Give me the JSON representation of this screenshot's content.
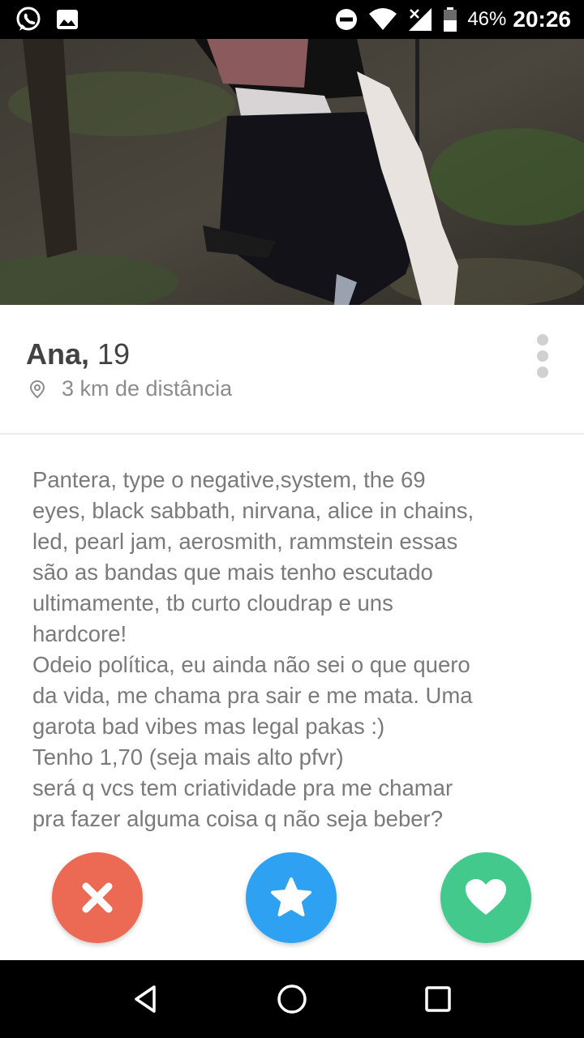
{
  "status_bar": {
    "battery_percent": "46%",
    "time": "20:26",
    "icons": [
      "whatsapp-icon",
      "image-icon",
      "do-not-disturb-icon",
      "wifi-icon",
      "signal-icon",
      "battery-icon"
    ]
  },
  "profile": {
    "name": "Ana,",
    "age": "19",
    "distance": "3 km de distância",
    "bio_lines": [
      "Pantera, type o negative,system, the 69",
      "eyes, black sabbath, nirvana, alice in chains,",
      "led, pearl jam, aerosmith, rammstein essas",
      "são as bandas que mais tenho escutado",
      "ultimamente, tb curto cloudrap e uns",
      "hardcore!",
      "Odeio política, eu ainda não sei o que quero",
      "da vida, me chama pra sair e me mata. Uma",
      "garota bad vibes mas legal pakas :)",
      "Tenho 1,70 (seja mais alto pfvr)",
      "será q vcs tem criatividade pra me chamar",
      "pra fazer alguma coisa q não seja beber?"
    ]
  },
  "actions": {
    "nope_color": "#ec6a53",
    "super_like_color": "#2fa1f2",
    "like_color": "#44c98c"
  },
  "nav": {
    "buttons": [
      "back-icon",
      "home-icon",
      "recents-icon"
    ]
  }
}
